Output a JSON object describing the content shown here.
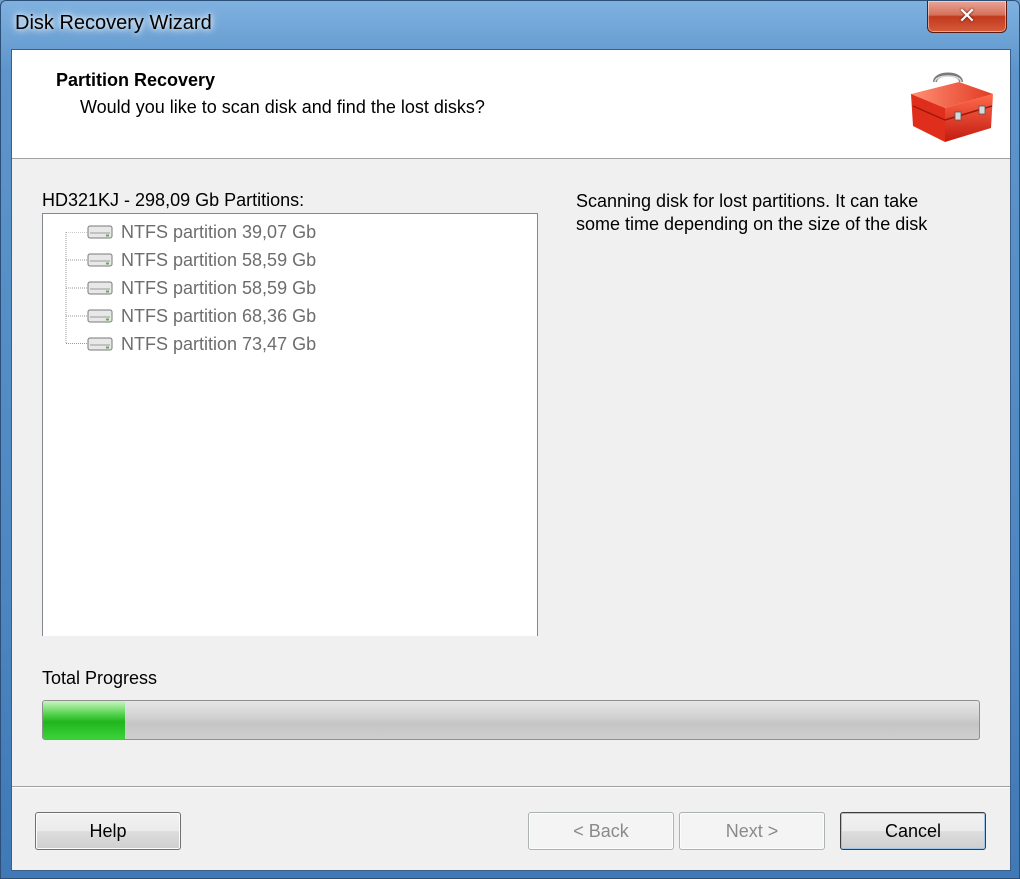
{
  "window": {
    "title": "Disk Recovery Wizard",
    "close_label": "x"
  },
  "header": {
    "title": "Partition Recovery",
    "subtitle": "Would you like to scan disk and find the lost disks?",
    "icon": "toolbox-icon"
  },
  "tree": {
    "label": "HD321KJ - 298,09 Gb Partitions:",
    "items": [
      {
        "label": "NTFS partition 39,07 Gb",
        "icon": "disk-icon"
      },
      {
        "label": "NTFS partition 58,59 Gb",
        "icon": "disk-icon"
      },
      {
        "label": "NTFS partition 58,59 Gb",
        "icon": "disk-icon"
      },
      {
        "label": "NTFS partition 68,36 Gb",
        "icon": "disk-icon"
      },
      {
        "label": "NTFS partition 73,47 Gb",
        "icon": "disk-icon"
      }
    ]
  },
  "info_text": "Scanning disk for lost partitions. It can take some time depending on the size of the disk",
  "progress": {
    "label": "Total Progress",
    "fraction": 0.088,
    "color": "#2ebd2a"
  },
  "buttons": {
    "help": "Help",
    "back": "< Back",
    "next": "Next >",
    "cancel": "Cancel"
  }
}
